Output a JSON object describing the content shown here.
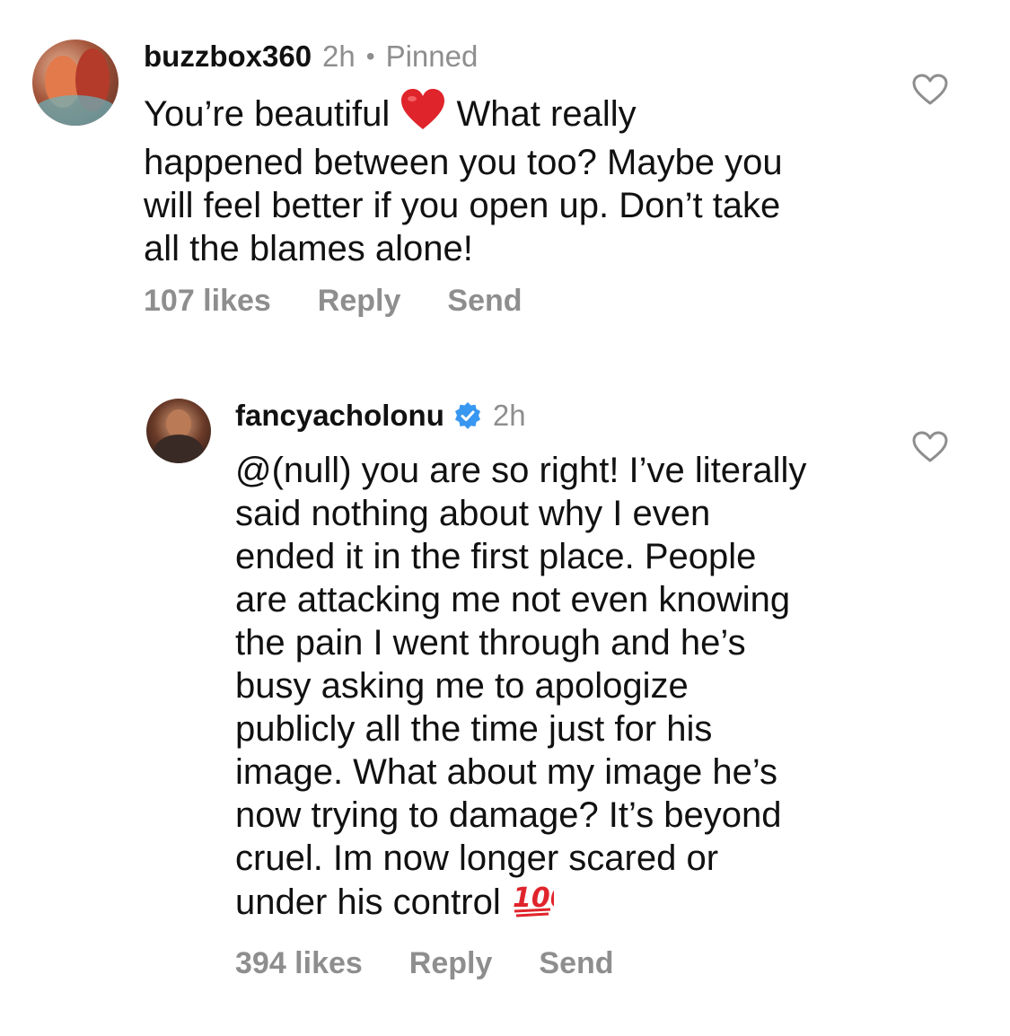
{
  "comments": [
    {
      "username": "buzzbox360",
      "time": "2h",
      "pinned_label": "Pinned",
      "line1_a": "You’re beautiful ",
      "line1_b": " What really",
      "rest": "happened between you too? Maybe you\nwill feel better if you open up. Don’t take\nall the blames alone!",
      "emoji": "heart-emoji",
      "likes": "107 likes",
      "reply_label": "Reply",
      "send_label": "Send"
    },
    {
      "username": "fancyacholonu",
      "time": "2h",
      "verified": true,
      "text": "@(null) you are so right! I’ve literally\nsaid nothing about why I even\nended it in the first place. People\nare attacking me not even knowing\nthe pain I went through and he’s\nbusy asking me to apologize\npublicly all the time just for his\nimage. What about my image he’s\nnow trying to damage? It’s beyond\ncruel. Im now longer scared or\nunder his control ",
      "emoji": "hundred-points-emoji",
      "likes": "394 likes",
      "reply_label": "Reply",
      "send_label": "Send"
    }
  ],
  "colors": {
    "text": "#111111",
    "meta": "#8e8e8e",
    "verified": "#3897f0",
    "heart_emoji": "#e0242b"
  }
}
